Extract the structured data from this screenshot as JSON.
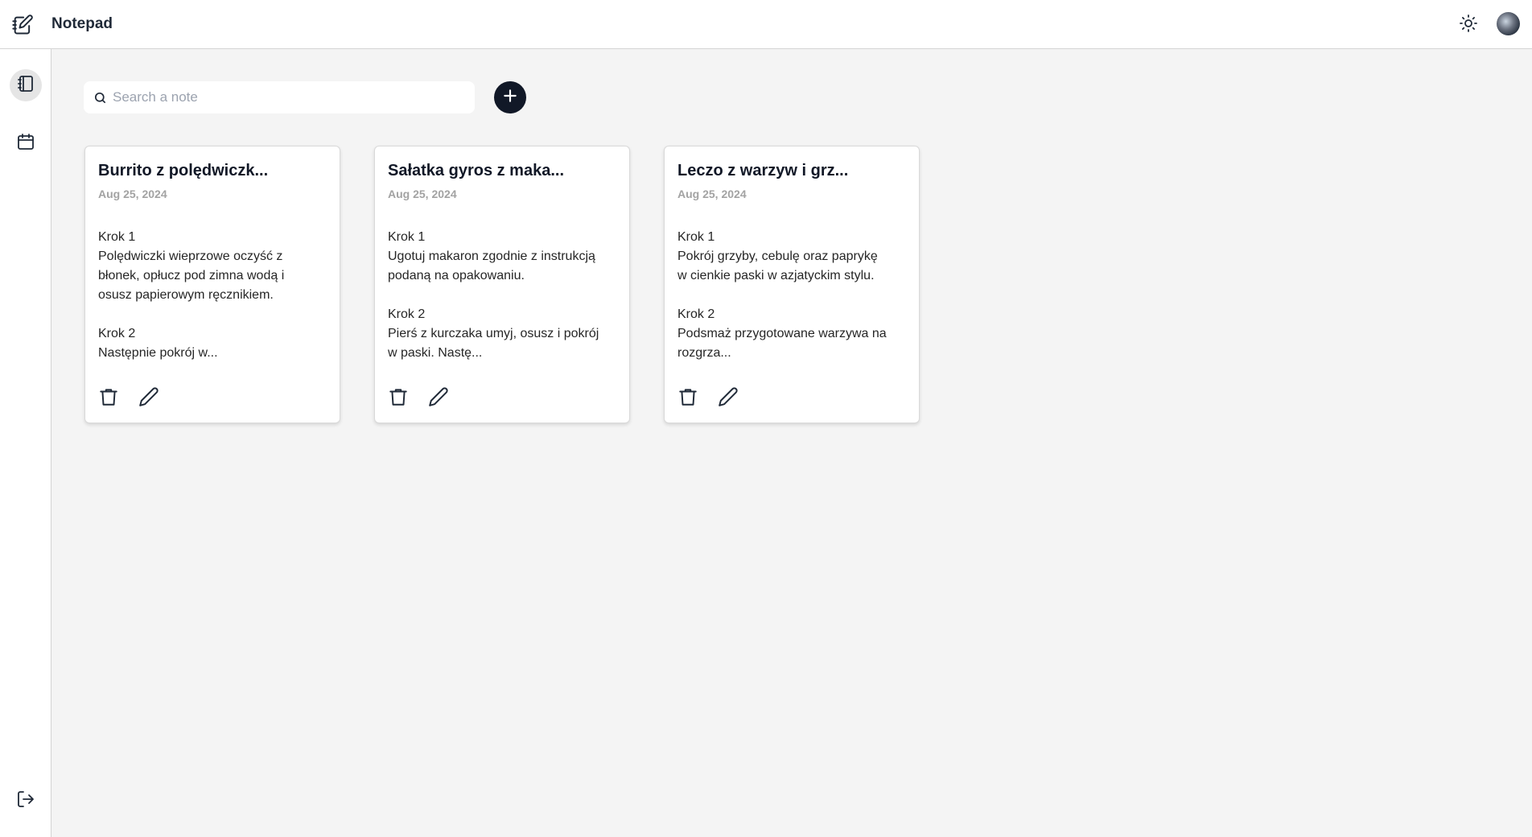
{
  "app": {
    "title": "Notepad"
  },
  "search": {
    "placeholder": "Search a note"
  },
  "notes": [
    {
      "title": "Burrito z polędwiczk...",
      "date": "Aug 25, 2024",
      "lines": [
        "Krok 1",
        "Polędwiczki wieprzowe oczyść z",
        "błonek, opłucz pod zimna wodą i",
        "osusz papierowym ręcznikiem.",
        "",
        "Krok 2",
        "Następnie pokrój w..."
      ]
    },
    {
      "title": "Sałatka gyros z maka...",
      "date": "Aug 25, 2024",
      "lines": [
        "Krok 1",
        "Ugotuj makaron zgodnie z instrukcją",
        "podaną na opakowaniu.",
        "",
        "Krok 2",
        "Pierś z kurczaka umyj, osusz i pokrój",
        "w paski. Nastę..."
      ]
    },
    {
      "title": "Leczo z warzyw i grz...",
      "date": "Aug 25, 2024",
      "lines": [
        "Krok 1",
        "Pokrój grzyby, cebulę oraz paprykę",
        "w cienkie paski w azjatyckim stylu.",
        "",
        "Krok 2",
        "Podsmaż przygotowane warzywa na",
        "rozgrza..."
      ]
    }
  ],
  "icons": {
    "app": "notepad-pen-icon",
    "theme": "sun-icon",
    "notes": "notebook-icon",
    "calendar": "calendar-icon",
    "logout": "logout-icon",
    "search": "search-icon",
    "add": "plus-icon",
    "delete": "trash-icon",
    "edit": "pencil-icon"
  },
  "colors": {
    "accent": "#111827",
    "background": "#f4f4f4",
    "date": "#a3a3a3"
  }
}
